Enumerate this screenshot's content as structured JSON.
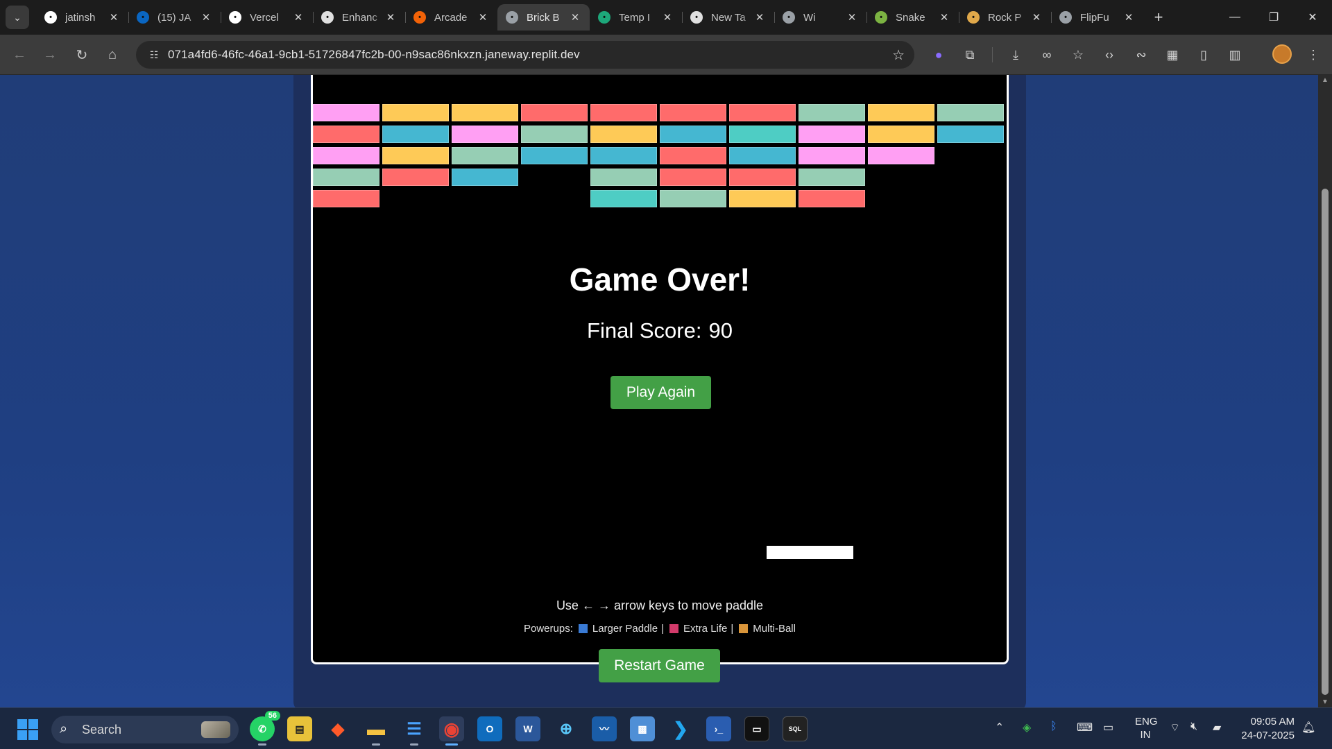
{
  "browser": {
    "tabs": [
      {
        "label": "jatinsh",
        "icon": "github-icon",
        "icon_color": "#ffffff",
        "active": false
      },
      {
        "label": "(15) JA",
        "icon": "linkedin-icon",
        "icon_color": "#0a66c2",
        "active": false
      },
      {
        "label": "Vercel",
        "icon": "vercel-icon",
        "icon_color": "#ffffff",
        "active": false
      },
      {
        "label": "Enhanc",
        "icon": "openai-icon",
        "icon_color": "#e0e0e0",
        "active": false
      },
      {
        "label": "Arcade",
        "icon": "arcade-icon",
        "icon_color": "#f26207",
        "active": false
      },
      {
        "label": "Brick B",
        "icon": "globe-icon",
        "icon_color": "#9aa0a6",
        "active": true
      },
      {
        "label": "Temp I",
        "icon": "temp-icon",
        "icon_color": "#1da77a",
        "active": false
      },
      {
        "label": "New Ta",
        "icon": "chrome-icon",
        "icon_color": "#e0e0e0",
        "active": false
      },
      {
        "label": "Wi",
        "icon": "hammer-icon",
        "icon_color": "#9aa0a6",
        "active": false
      },
      {
        "label": "Snake",
        "icon": "snake-icon",
        "icon_color": "#7cb342",
        "active": false
      },
      {
        "label": "Rock P",
        "icon": "rock-icon",
        "icon_color": "#e0a84a",
        "active": false
      },
      {
        "label": "FlipFu",
        "icon": "globe-icon",
        "icon_color": "#9aa0a6",
        "active": false
      }
    ],
    "url": "071a4fd6-46fc-46a1-9cb1-51726847fc2b-00-n9sac86nkxzn.janeway.replit.dev"
  },
  "game": {
    "bricks": [
      {
        "col": 0,
        "row": 0,
        "color": "#ff9ff3"
      },
      {
        "col": 1,
        "row": 0,
        "color": "#feca57"
      },
      {
        "col": 2,
        "row": 0,
        "color": "#feca57"
      },
      {
        "col": 3,
        "row": 0,
        "color": "#ff6b6b"
      },
      {
        "col": 4,
        "row": 0,
        "color": "#ff6b6b"
      },
      {
        "col": 5,
        "row": 0,
        "color": "#ff6b6b"
      },
      {
        "col": 6,
        "row": 0,
        "color": "#ff6b6b"
      },
      {
        "col": 7,
        "row": 0,
        "color": "#96ceb4"
      },
      {
        "col": 8,
        "row": 0,
        "color": "#feca57"
      },
      {
        "col": 9,
        "row": 0,
        "color": "#96ceb4"
      },
      {
        "col": 0,
        "row": 1,
        "color": "#ff6b6b"
      },
      {
        "col": 1,
        "row": 1,
        "color": "#45b7d1"
      },
      {
        "col": 2,
        "row": 1,
        "color": "#ff9ff3"
      },
      {
        "col": 3,
        "row": 1,
        "color": "#96ceb4"
      },
      {
        "col": 4,
        "row": 1,
        "color": "#feca57"
      },
      {
        "col": 5,
        "row": 1,
        "color": "#45b7d1"
      },
      {
        "col": 6,
        "row": 1,
        "color": "#4ecdc4"
      },
      {
        "col": 7,
        "row": 1,
        "color": "#ff9ff3"
      },
      {
        "col": 8,
        "row": 1,
        "color": "#feca57"
      },
      {
        "col": 9,
        "row": 1,
        "color": "#45b7d1"
      },
      {
        "col": 0,
        "row": 2,
        "color": "#ff9ff3"
      },
      {
        "col": 1,
        "row": 2,
        "color": "#feca57"
      },
      {
        "col": 2,
        "row": 2,
        "color": "#96ceb4"
      },
      {
        "col": 3,
        "row": 2,
        "color": "#45b7d1"
      },
      {
        "col": 4,
        "row": 2,
        "color": "#45b7d1"
      },
      {
        "col": 5,
        "row": 2,
        "color": "#ff6b6b"
      },
      {
        "col": 6,
        "row": 2,
        "color": "#45b7d1"
      },
      {
        "col": 7,
        "row": 2,
        "color": "#ff9ff3"
      },
      {
        "col": 8,
        "row": 2,
        "color": "#ff9ff3"
      },
      {
        "col": 0,
        "row": 3,
        "color": "#96ceb4"
      },
      {
        "col": 1,
        "row": 3,
        "color": "#ff6b6b"
      },
      {
        "col": 2,
        "row": 3,
        "color": "#45b7d1"
      },
      {
        "col": 4,
        "row": 3,
        "color": "#96ceb4"
      },
      {
        "col": 5,
        "row": 3,
        "color": "#ff6b6b"
      },
      {
        "col": 6,
        "row": 3,
        "color": "#ff6b6b"
      },
      {
        "col": 7,
        "row": 3,
        "color": "#96ceb4"
      },
      {
        "col": 0,
        "row": 4,
        "color": "#ff6b6b"
      },
      {
        "col": 4,
        "row": 4,
        "color": "#4ecdc4"
      },
      {
        "col": 5,
        "row": 4,
        "color": "#96ceb4"
      },
      {
        "col": 6,
        "row": 4,
        "color": "#feca57"
      },
      {
        "col": 7,
        "row": 4,
        "color": "#ff6b6b"
      }
    ],
    "game_over_title": "Game Over!",
    "final_score_label": "Final Score:",
    "final_score": "90",
    "play_again_label": "Play Again"
  },
  "instructions": "Use ← → arrow keys to move paddle",
  "powerups": {
    "label": "Powerups:",
    "items": [
      {
        "label": "Larger Paddle",
        "color": "#3a7bd5"
      },
      {
        "label": "Extra Life",
        "color": "#d23a6a"
      },
      {
        "label": "Multi-Ball",
        "color": "#d9953a"
      }
    ]
  },
  "restart_label": "Restart Game",
  "taskbar": {
    "search_placeholder": "Search",
    "whatsapp_badge": "56",
    "lang_line1": "ENG",
    "lang_line2": "IN",
    "time": "09:05 AM",
    "date": "24-07-2025"
  },
  "colors": {
    "accent_green": "#43a046",
    "page_bg": "#1f3f82"
  }
}
